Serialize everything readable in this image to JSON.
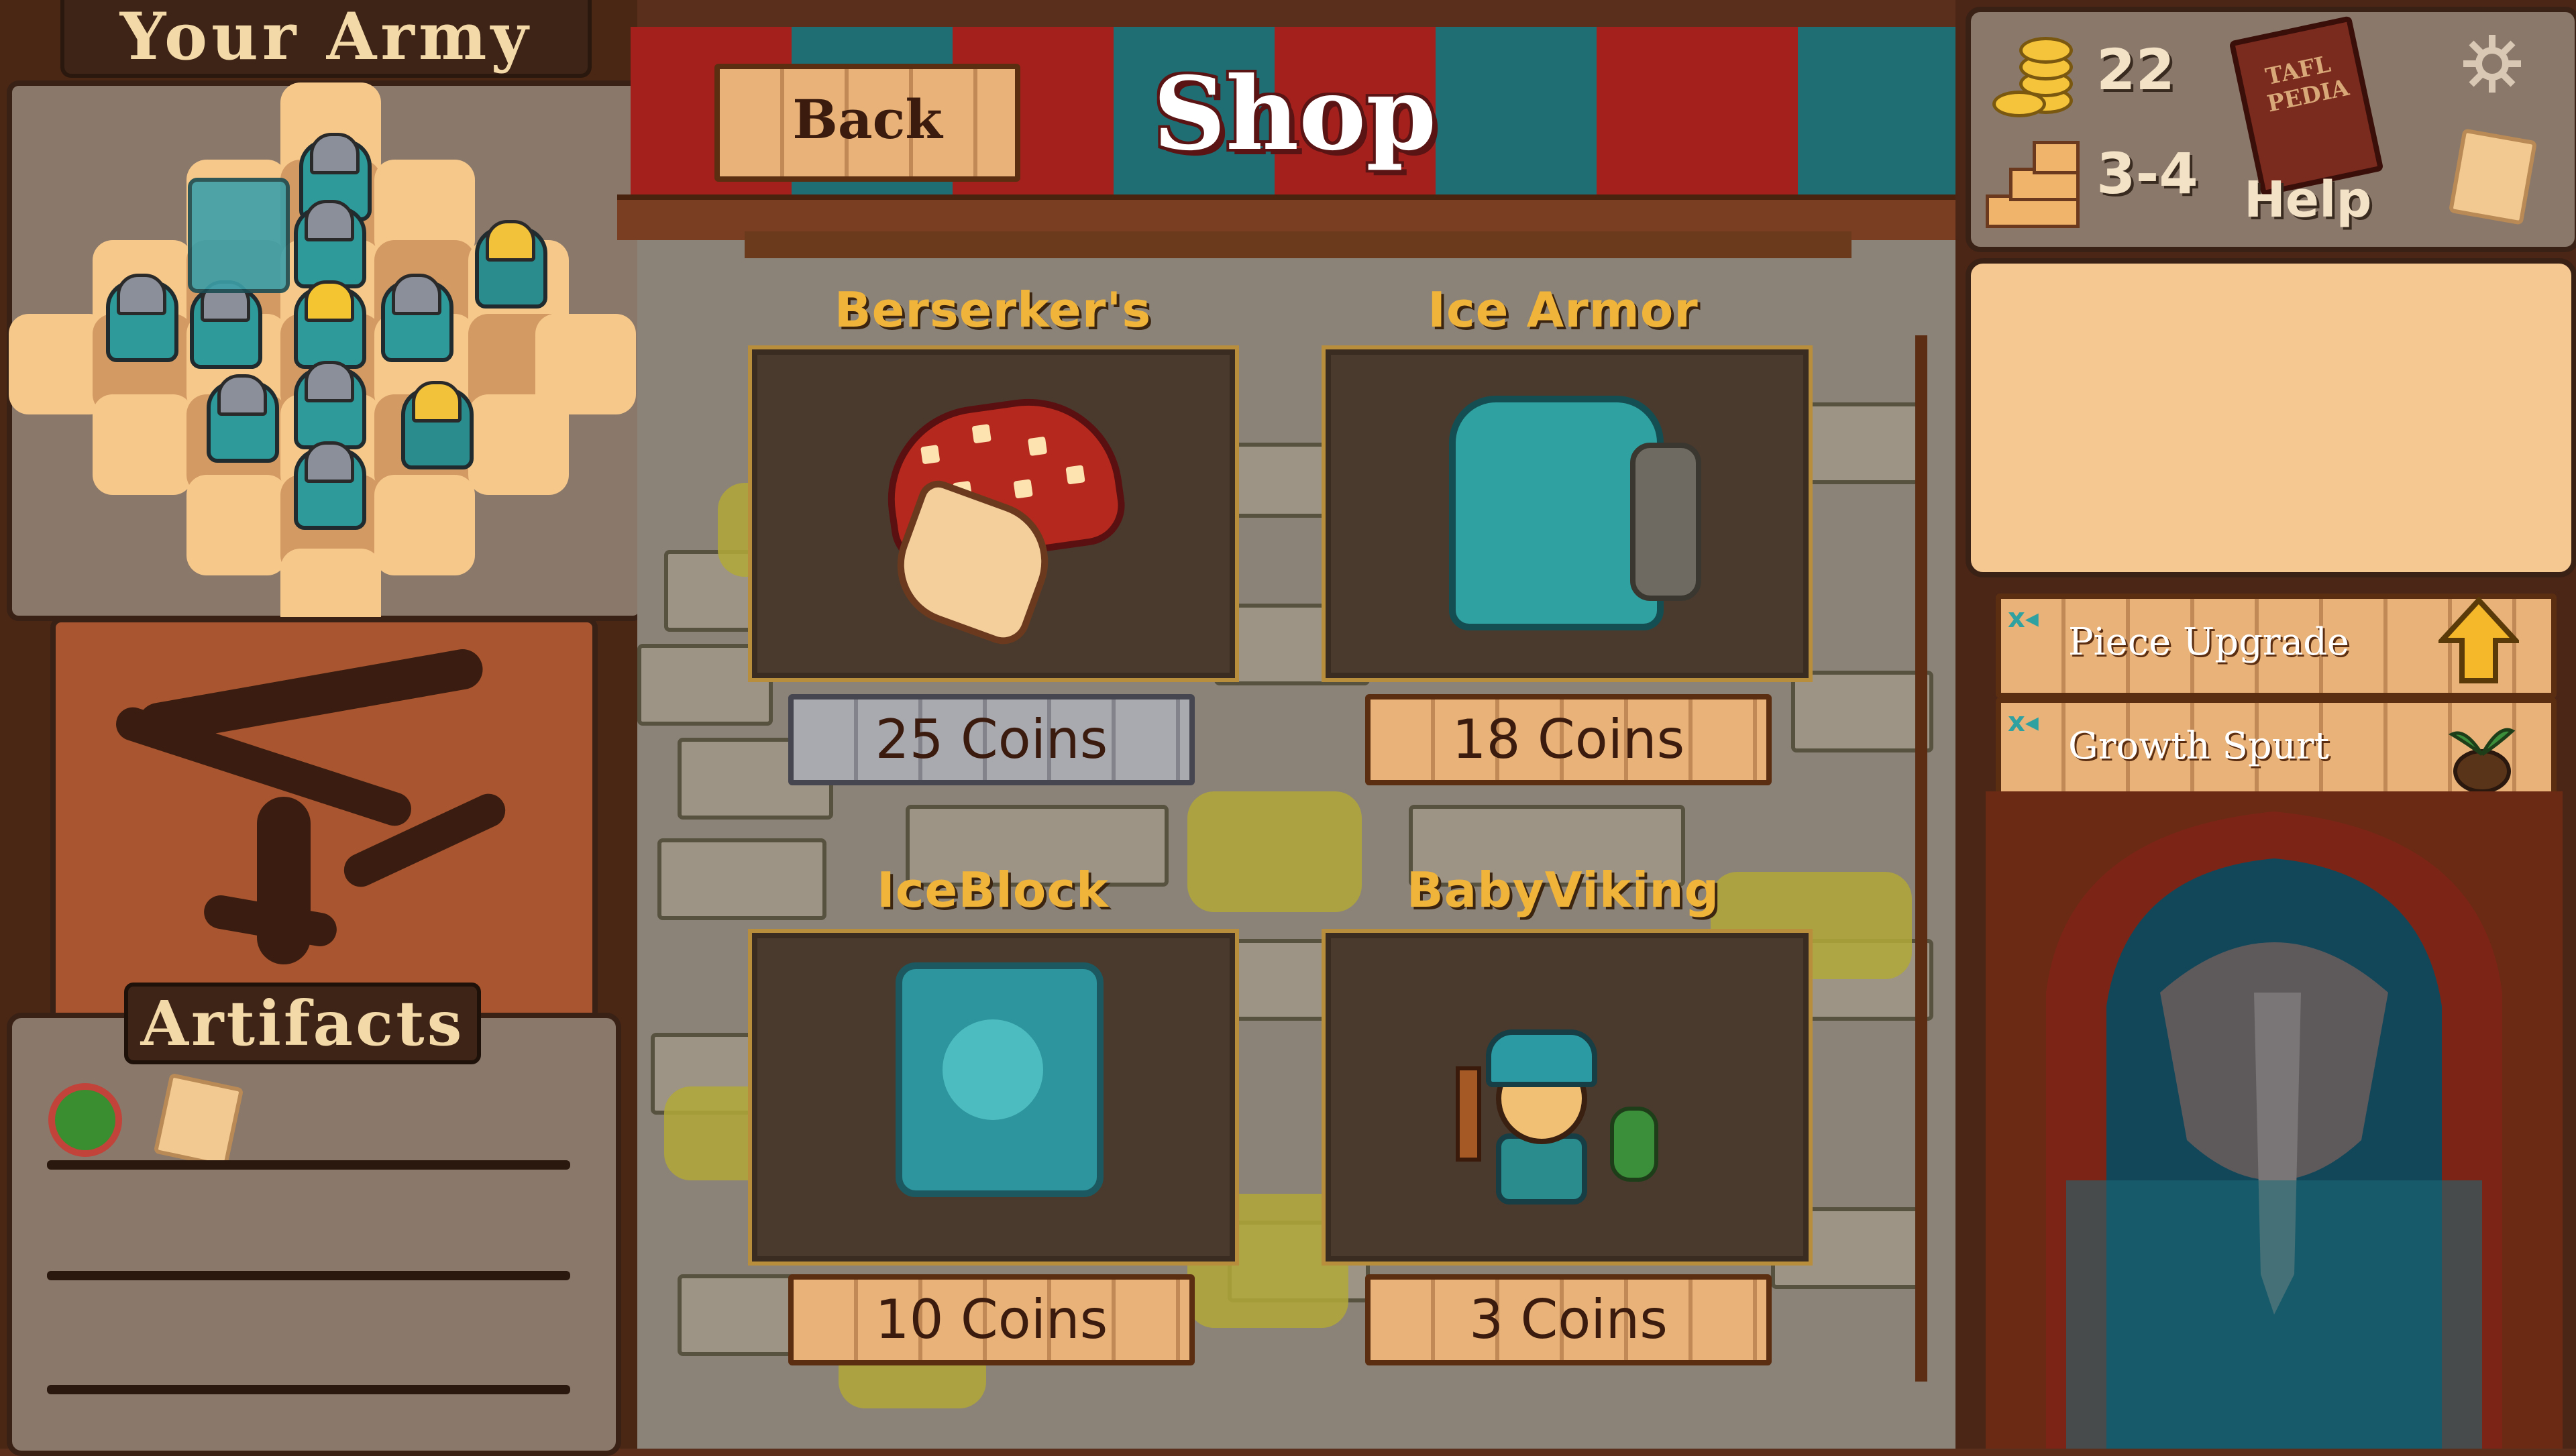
{
  "left_panel": {
    "army_title": "Your Army",
    "artifacts_title": "Artifacts",
    "artifacts": [
      {
        "icon": "round-shield-icon"
      },
      {
        "icon": "scroll-icon"
      }
    ]
  },
  "shop": {
    "title": "Shop",
    "back_label": "Back",
    "items": [
      {
        "name": "Berserker's Mushroom",
        "price": "25 Coins",
        "icon": "mushroom-icon",
        "affordable": false
      },
      {
        "name": "Ice Armor",
        "price": "18 Coins",
        "icon": "ice-armor-icon",
        "affordable": true
      },
      {
        "name": "IceBlock",
        "price": "10 Coins",
        "icon": "ice-block-icon",
        "affordable": true
      },
      {
        "name": "BabyViking",
        "price": "3 Coins",
        "icon": "baby-viking-icon",
        "affordable": true
      }
    ]
  },
  "stats": {
    "coins": "22",
    "floor": "3-4",
    "help_label": "Help",
    "book_title": "TAFL PEDIA"
  },
  "upgrades": [
    {
      "label": "Piece Upgrade",
      "icon": "up-arrow-icon"
    },
    {
      "label": "Growth Spurt",
      "icon": "sprout-icon"
    }
  ],
  "colors": {
    "awning_red": "#a3201c",
    "awning_teal": "#1f6e73",
    "price_gold": "#f0b43a",
    "plank": "#e8b278",
    "info_box": "#f5c891"
  }
}
